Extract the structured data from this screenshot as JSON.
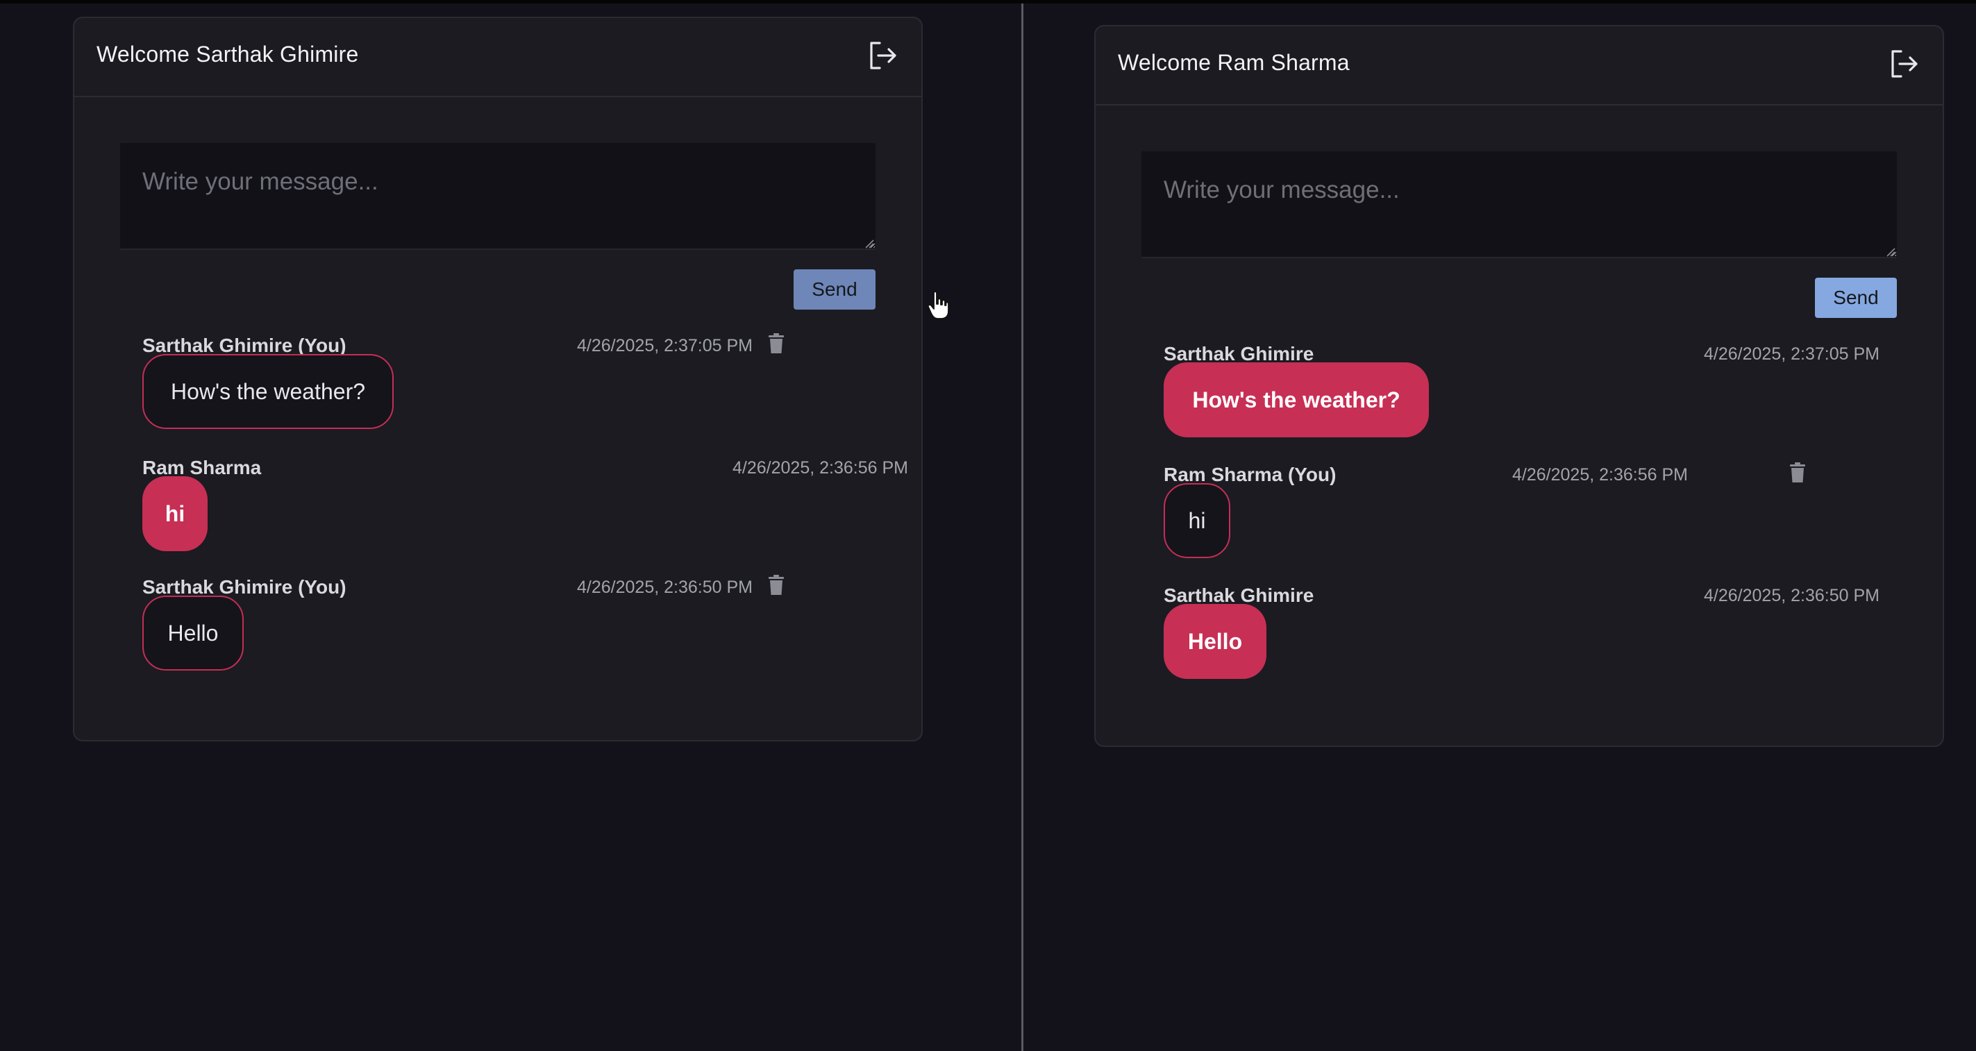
{
  "left_window": {
    "welcome": "Welcome Sarthak Ghimire",
    "composer_placeholder": "Write your message...",
    "send_label": "Send",
    "messages": [
      {
        "sender": "Sarthak Ghimire (You)",
        "timestamp": "4/26/2025, 2:37:05 PM",
        "text": "How's the weather?",
        "own": true
      },
      {
        "sender": "Ram Sharma",
        "timestamp": "4/26/2025, 2:36:56 PM",
        "text": "hi",
        "own": false
      },
      {
        "sender": "Sarthak Ghimire (You)",
        "timestamp": "4/26/2025, 2:36:50 PM",
        "text": "Hello",
        "own": true
      }
    ]
  },
  "right_window": {
    "welcome": "Welcome Ram Sharma",
    "composer_placeholder": "Write your message...",
    "send_label": "Send",
    "messages": [
      {
        "sender": "Sarthak Ghimire",
        "timestamp": "4/26/2025, 2:37:05 PM",
        "text": "How's the weather?",
        "own": false
      },
      {
        "sender": "Ram Sharma (You)",
        "timestamp": "4/26/2025, 2:36:56 PM",
        "text": "hi",
        "own": true
      },
      {
        "sender": "Sarthak Ghimire",
        "timestamp": "4/26/2025, 2:36:50 PM",
        "text": "Hello",
        "own": false
      }
    ]
  },
  "icons": {
    "logout": "logout-icon",
    "delete": "trash-icon"
  },
  "colors": {
    "page_background": "#13121a",
    "card_background": "#1b1b21",
    "accent_pink": "#c72f55",
    "send_button_left": "#6e87b8",
    "send_button_right": "#86a8e0"
  }
}
